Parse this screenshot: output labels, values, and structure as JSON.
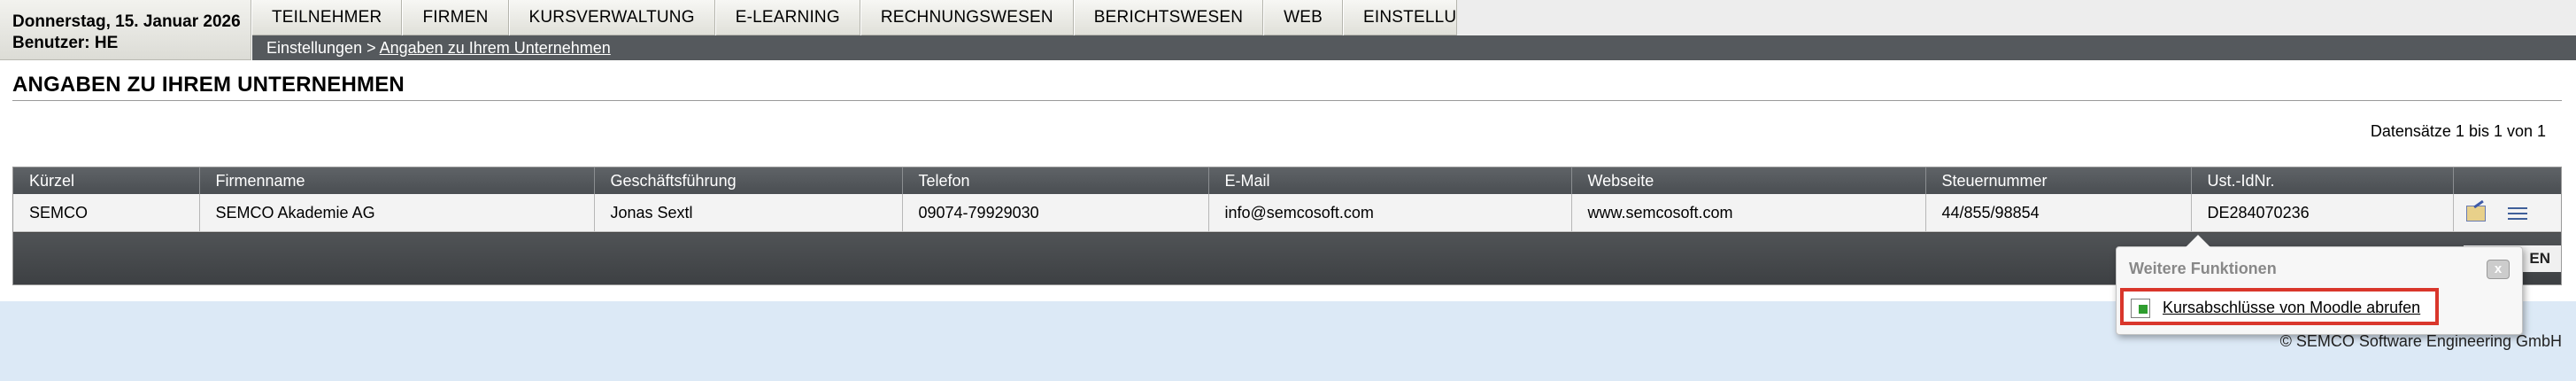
{
  "header": {
    "date": "Donnerstag, 15. Januar 2026",
    "user": "Benutzer: HE"
  },
  "menu": [
    {
      "label": "TEILNEHMER"
    },
    {
      "label": "FIRMEN"
    },
    {
      "label": "KURSVERWALTUNG"
    },
    {
      "label": "E-LEARNING"
    },
    {
      "label": "RECHNUNGSWESEN"
    },
    {
      "label": "BERICHTSWESEN"
    },
    {
      "label": "WEB"
    },
    {
      "label": "EINSTELLUNGEN"
    }
  ],
  "breadcrumb": {
    "root": "Einstellungen",
    "separator": " > ",
    "current": "Angaben zu Ihrem Unternehmen"
  },
  "page_title": "ANGABEN ZU IHREM UNTERNEHMEN",
  "records_info": "Datensätze 1 bis 1 von 1",
  "table": {
    "headers": [
      "Kürzel",
      "Firmenname",
      "Geschäftsführung",
      "Telefon",
      "E-Mail",
      "Webseite",
      "Steuernummer",
      "Ust.-IdNr."
    ],
    "rows": [
      [
        "SEMCO",
        "SEMCO Akademie AG",
        "Jonas Sextl",
        "09074-79929030",
        "info@semcosoft.com",
        "www.semcosoft.com",
        "44/855/98854",
        "DE284070236"
      ]
    ]
  },
  "footer_button_partial": "EN",
  "popup": {
    "title": "Weitere Funktionen",
    "close": "x",
    "link": "Kursabschlüsse von Moodle abrufen"
  },
  "copyright": "© SEMCO   Software Engineering GmbH",
  "colors": {
    "header_bar": "#55595d",
    "table_header": "#4a4e52",
    "highlight_border": "#d9362b",
    "page_background": "#dce9f6"
  }
}
